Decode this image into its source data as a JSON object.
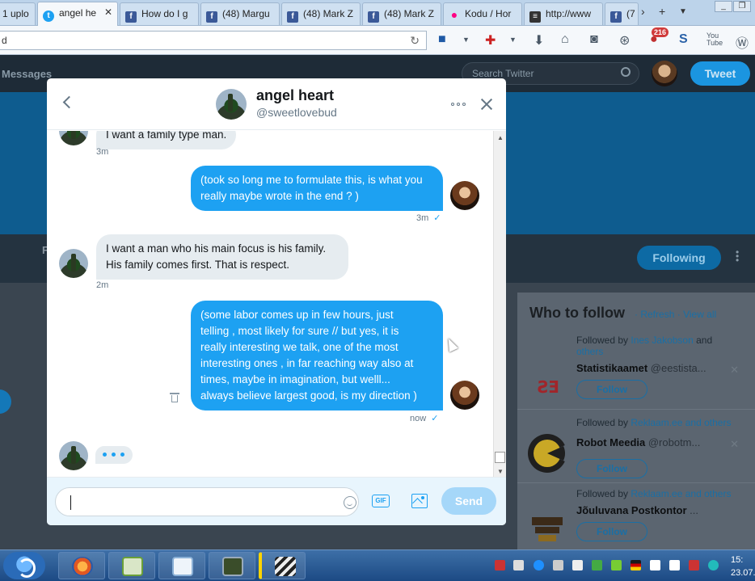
{
  "browser": {
    "tabs": [
      {
        "label": "1 uplo",
        "icon": "upload-icon"
      },
      {
        "label": "angel he",
        "icon": "twitter-icon",
        "active": true
      },
      {
        "label": "How do I g",
        "icon": "facebook-icon"
      },
      {
        "label": "(48) Margu",
        "icon": "facebook-icon"
      },
      {
        "label": "(48) Mark Z",
        "icon": "facebook-icon"
      },
      {
        "label": "(48) Mark Z",
        "icon": "facebook-icon"
      },
      {
        "label": "Kodu / Hor",
        "icon": "flickr-icon"
      },
      {
        "label": "http://www",
        "icon": "news-icon"
      },
      {
        "label": "(7",
        "icon": "facebook-icon"
      }
    ],
    "tab_close": "✕",
    "new_tab": "+",
    "url_text": "d",
    "toolbar_badge": "216"
  },
  "twitter": {
    "nav_messages": "Messages",
    "search_placeholder": "Search Twitter",
    "tweet_button": "Tweet",
    "profile_letter": "F",
    "following_button": "Following",
    "who_to_follow": {
      "title": "Who to follow",
      "refresh": "Refresh",
      "view_all": "View all",
      "sep": "·",
      "suggestions": [
        {
          "followed_prefix": "Followed by",
          "followed_names": "Ines Jakobson",
          "followed_suffix": "and",
          "followed_line2": "others",
          "name": "Statistikaamet",
          "handle": "@eestista...",
          "follow": "Follow"
        },
        {
          "followed_prefix": "Followed by",
          "followed_names": "Reklaam.ee",
          "followed_suffix": "and others",
          "followed_line2": "",
          "name": "Robot Meedia",
          "handle": "@robotm...",
          "follow": "Follow"
        },
        {
          "followed_prefix": "Followed by",
          "followed_names": "Reklaam.ee",
          "followed_suffix": "and others",
          "followed_line2": "",
          "name": "Jõuluvana Postkontor",
          "handle": "...",
          "follow": "Follow"
        }
      ]
    }
  },
  "dm": {
    "contact_name": "angel heart",
    "contact_handle": "@sweetlovebud",
    "messages": [
      {
        "dir": "in",
        "text": "I want a family type man.",
        "time": "3m"
      },
      {
        "dir": "out",
        "lines": [
          "(took so long me to formulate this, is what you",
          "really maybe wrote in the end ? )"
        ],
        "time": "3m",
        "check": "✓"
      },
      {
        "dir": "in",
        "lines": [
          "I want a man who his main focus is his family.",
          "His family comes first.  That is respect."
        ],
        "time": "2m"
      },
      {
        "dir": "out",
        "lines": [
          "(some labor  comes up in few hours,  just",
          "telling , most likely for sure  // but yes, it is",
          "really interesting we talk, one of the most",
          "interesting ones , in far reaching way also at",
          "times, maybe in imagination, but welll...",
          "always believe largest good, is my direction  )"
        ],
        "time": "now",
        "check": "✓"
      }
    ],
    "compose": {
      "value": "",
      "send": "Send",
      "gif": "GIF"
    }
  },
  "taskbar": {
    "clock_time": "15:",
    "clock_date": "23.07."
  },
  "colors": {
    "twitter_blue": "#1da1f2",
    "bubble_in": "#e6ecf0",
    "send_disabled": "#a5d7f9"
  }
}
